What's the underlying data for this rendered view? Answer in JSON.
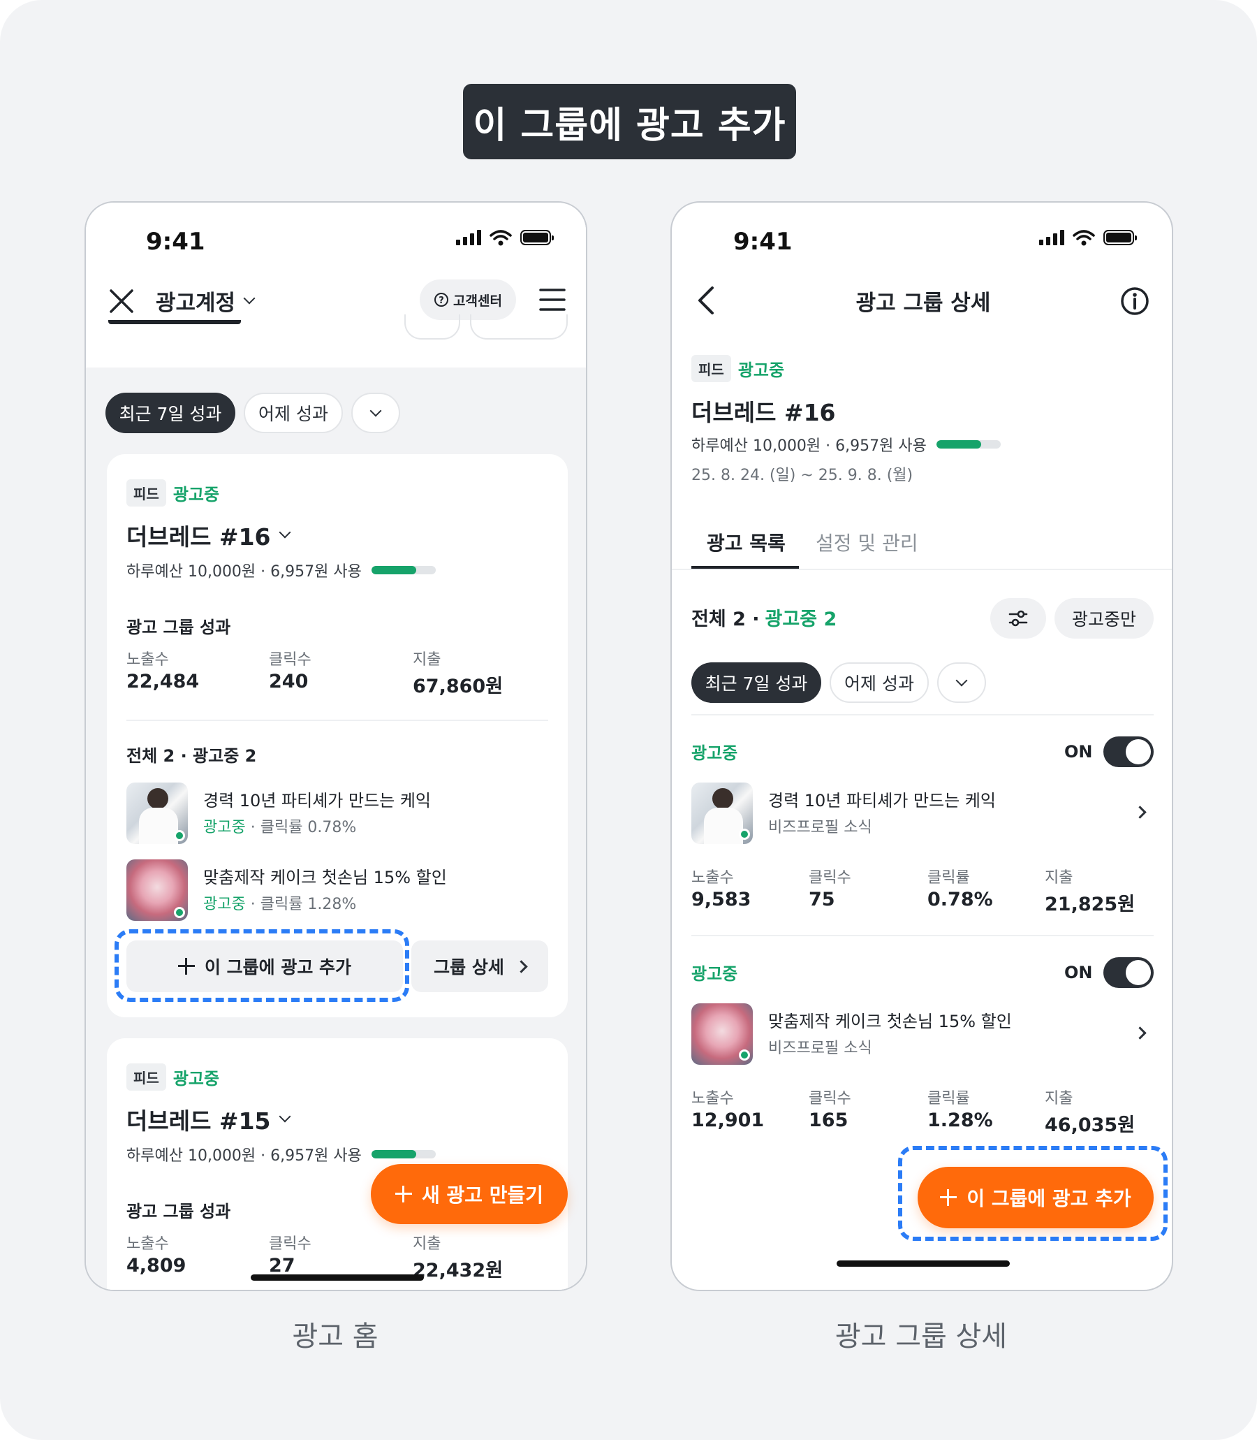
{
  "title": "이 그룹에 광고 추가",
  "captions": {
    "left": "광고 홈",
    "right": "광고 그룹 상세"
  },
  "colors": {
    "accent_orange": "#ff6a0b",
    "status_green": "#16a36a",
    "highlight_blue": "#2b7cf6",
    "dark": "#2b3037"
  },
  "left": {
    "status_time": "9:41",
    "account_label": "광고계정",
    "help_label": "고객센터",
    "filter_recent": "최근 7일 성과",
    "filter_yesterday": "어제 성과",
    "group1": {
      "type": "피드",
      "status": "광고중",
      "name": "더브레드 #16",
      "budget": "하루예산 10,000원 · 6,957원 사용",
      "budget_used_ratio": 0.6957,
      "perf_title": "광고 그룹 성과",
      "stats": [
        {
          "label": "노출수",
          "value": "22,484"
        },
        {
          "label": "클릭수",
          "value": "240"
        },
        {
          "label": "지출",
          "value": "67,860원"
        }
      ],
      "summary_bold": "전체 2 · 광고중 2",
      "ads": [
        {
          "name": "경력 10년 파티셰가 만드는 케익",
          "status": "광고중",
          "meta": "· 클릭률 0.78%"
        },
        {
          "name": "맞춤제작 케이크 첫손님 15% 할인",
          "status": "광고중",
          "meta": "· 클릭률 1.28%"
        }
      ],
      "add_button": "이 그룹에 광고 추가",
      "detail_button": "그룹 상세"
    },
    "group2": {
      "type": "피드",
      "status": "광고중",
      "name": "더브레드 #15",
      "budget": "하루예산 10,000원 · 6,957원 사용",
      "budget_used_ratio": 0.6957,
      "perf_title": "광고 그룹 성과",
      "stats": [
        {
          "label": "노출수",
          "value": "4,809"
        },
        {
          "label": "클릭수",
          "value": "27"
        },
        {
          "label": "지출",
          "value": "22,432원"
        }
      ]
    },
    "fab_label": "새 광고 만들기"
  },
  "right": {
    "status_time": "9:41",
    "page_title": "광고 그룹 상세",
    "type": "피드",
    "status": "광고중",
    "name": "더브레드 #16",
    "budget": "하루예산 10,000원 · 6,957원 사용",
    "budget_used_ratio": 0.6957,
    "period": "25. 8. 24. (일) ~ 25. 9. 8. (월)",
    "tabs": [
      "광고 목록",
      "설정 및 관리"
    ],
    "count_total": "전체 2 ·",
    "count_active": "광고중 2",
    "filter_active_only": "광고중만",
    "filter_recent": "최근 7일 성과",
    "filter_yesterday": "어제 성과",
    "ads": [
      {
        "status": "광고중",
        "toggle": "ON",
        "name": "경력 10년 파티셰가 만드는 케익",
        "sub": "비즈프로필 소식",
        "stats": [
          {
            "label": "노출수",
            "value": "9,583"
          },
          {
            "label": "클릭수",
            "value": "75"
          },
          {
            "label": "클릭률",
            "value": "0.78%"
          },
          {
            "label": "지출",
            "value": "21,825원"
          }
        ]
      },
      {
        "status": "광고중",
        "toggle": "ON",
        "name": "맞춤제작 케이크 첫손님 15% 할인",
        "sub": "비즈프로필 소식",
        "stats": [
          {
            "label": "노출수",
            "value": "12,901"
          },
          {
            "label": "클릭수",
            "value": "165"
          },
          {
            "label": "클릭률",
            "value": "1.28%"
          },
          {
            "label": "지출",
            "value": "46,035원"
          }
        ]
      }
    ],
    "fab_label": "이 그룹에 광고 추가"
  }
}
